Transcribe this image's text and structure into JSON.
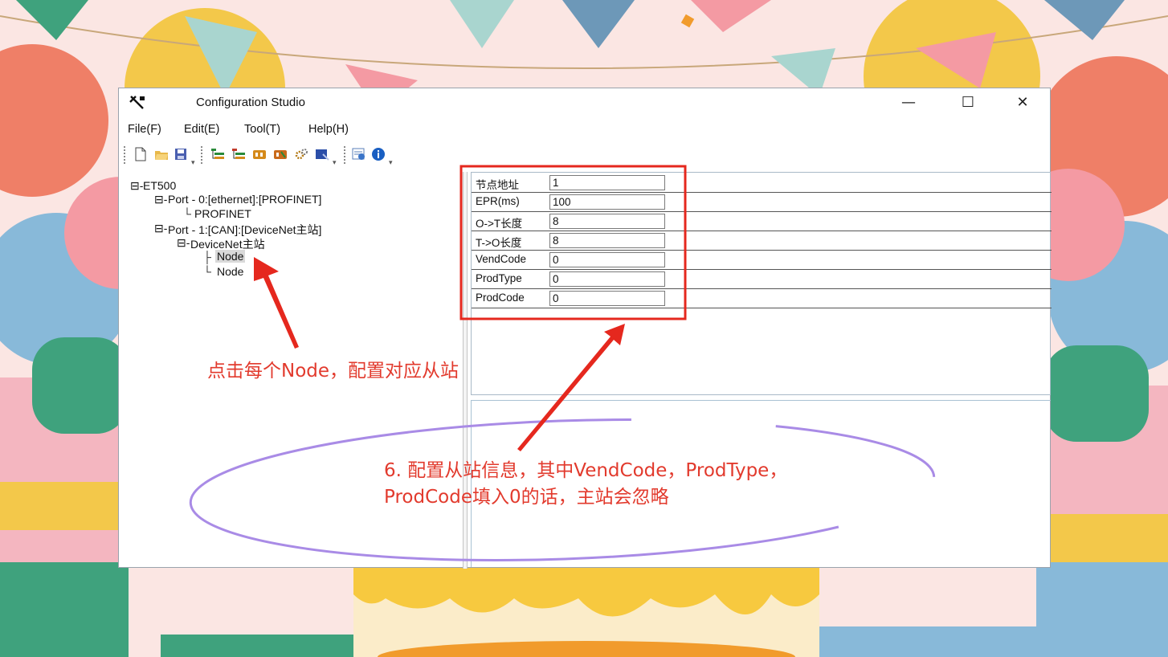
{
  "window": {
    "title": "Configuration Studio",
    "minimize": "—",
    "maximize": "☐",
    "close": "✕"
  },
  "menu": {
    "file": "File(F)",
    "edit": "Edit(E)",
    "tool": "Tool(T)",
    "help": "Help(H)"
  },
  "toolbar": {
    "icons": [
      "new-file-icon",
      "open-folder-icon",
      "save-icon",
      "add-port-icon",
      "remove-port-icon",
      "add-module-icon",
      "remove-module-icon",
      "settings-icon",
      "download-icon",
      "monitor-icon",
      "info-icon"
    ]
  },
  "tree": {
    "root": "ET500",
    "port0": "Port - 0:[ethernet]:[PROFINET]",
    "port0_child": "PROFINET",
    "port1": "Port - 1:[CAN]:[DeviceNet主站]",
    "master": "DeviceNet主站",
    "node1": "Node",
    "node2": "Node"
  },
  "properties": [
    {
      "label": "节点地址",
      "value": "1"
    },
    {
      "label": "EPR(ms)",
      "value": "100"
    },
    {
      "label": "O->T长度",
      "value": "8"
    },
    {
      "label": "T->O长度",
      "value": "8"
    },
    {
      "label": "VendCode",
      "value": "0"
    },
    {
      "label": "ProdType",
      "value": "0"
    },
    {
      "label": "ProdCode",
      "value": "0"
    }
  ],
  "annotations": {
    "note1": "点击每个Node，配置对应从站",
    "note2_line1": "6. 配置从站信息，其中VendCode，ProdType，",
    "note2_line2": "ProdCode填入0的话，主站会忽略"
  },
  "colors": {
    "annotation": "#e23a2d",
    "highlight_box": "#e5281e",
    "ellipse": "#a98be6"
  }
}
